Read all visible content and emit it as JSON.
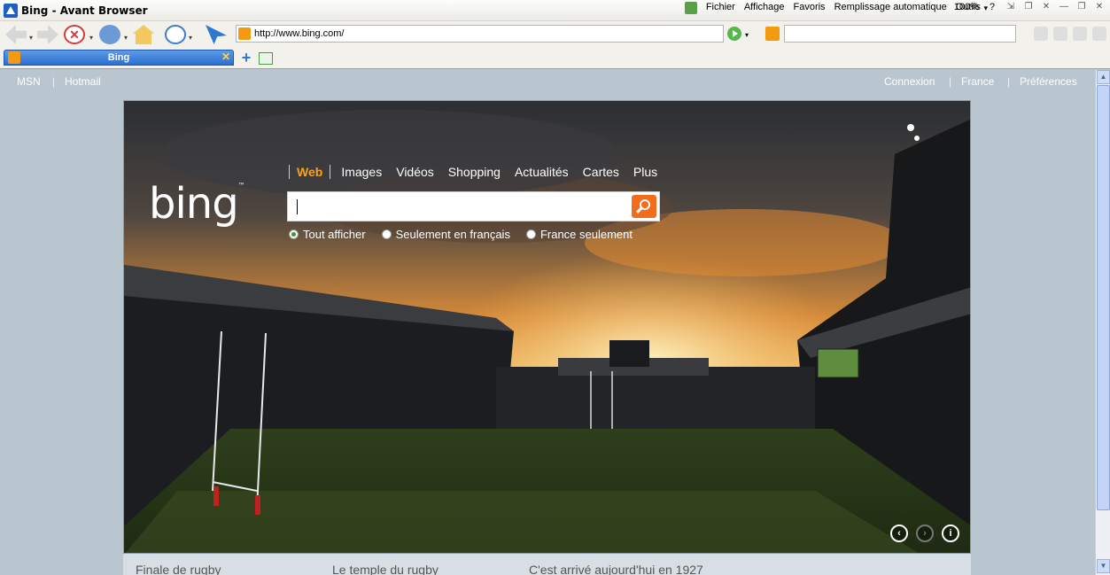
{
  "window": {
    "title": "Bing - Avant Browser",
    "menu": [
      "Fichier",
      "Affichage",
      "Favoris",
      "Remplissage automatique",
      "Outils",
      "?"
    ],
    "zoom": "100%"
  },
  "toolbar": {
    "address": "http://www.bing.com/"
  },
  "tabs": [
    {
      "label": "Bing"
    }
  ],
  "site_nav": {
    "left": [
      "MSN",
      "Hotmail"
    ],
    "right": [
      "Connexion",
      "France",
      "Préférences"
    ]
  },
  "bing": {
    "logo": "bing",
    "scopes": [
      "Web",
      "Images",
      "Vidéos",
      "Shopping",
      "Actualités",
      "Cartes",
      "Plus"
    ],
    "search_value": "",
    "radios": [
      {
        "label": "Tout afficher",
        "selected": true
      },
      {
        "label": "Seulement en français",
        "selected": false
      },
      {
        "label": "France seulement",
        "selected": false
      }
    ],
    "captions": [
      "Finale de rugby",
      "Le temple du rugby",
      "C'est arrivé aujourd'hui en 1927"
    ],
    "accent_color": "#f7a51a"
  }
}
